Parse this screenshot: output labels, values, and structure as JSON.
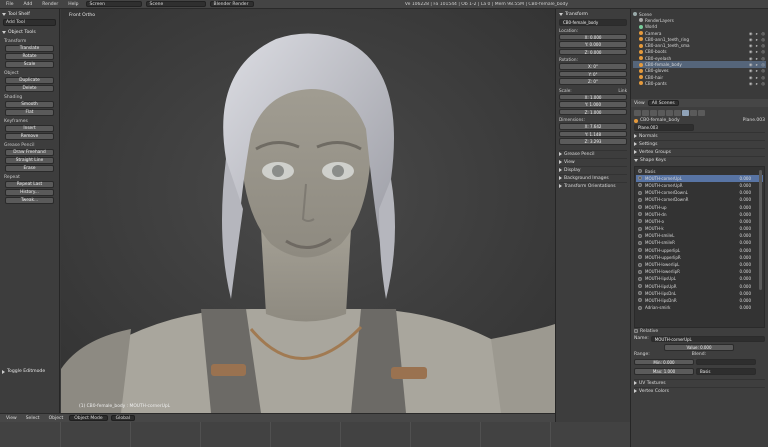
{
  "topbar": {
    "menus": [
      "File",
      "Add",
      "Render",
      "Help"
    ],
    "screen": "Screen",
    "scene": "Scene",
    "engine": "Blender Render",
    "stats": "Ve 106228 | Fa 101544 | Ob 1-2 | La 0 | Mem 98.55M | CB0-female_body"
  },
  "toolshelf": {
    "title": "Tool Shelf",
    "add_tool": "Add Tool",
    "object_tools": "Object Tools",
    "sections": [
      {
        "label": "Transform",
        "buttons": [
          "Translate",
          "Rotate",
          "Scale"
        ]
      },
      {
        "label": "Object",
        "buttons": [
          "Duplicate",
          "Delete"
        ]
      },
      {
        "label": "Shading",
        "buttons": [
          "Smooth",
          "Flat"
        ]
      },
      {
        "label": "Keyframes",
        "buttons": [
          "Insert",
          "Remove"
        ]
      },
      {
        "label": "Grease Pencil",
        "buttons": [
          "Draw Freehand",
          "Straight Line",
          "Erase"
        ]
      },
      {
        "label": "Repeat",
        "buttons": [
          "Repeat Last",
          "History...",
          "Tweak..."
        ]
      }
    ],
    "toggle_edit_mode": "Toggle Editmode"
  },
  "viewport": {
    "label": "Front Ortho",
    "object_label": "(1) CB0-female_body : MOUTH-cornerUpL"
  },
  "vp_header": {
    "items": [
      "View",
      "Select",
      "Object"
    ],
    "mode": "Object Mode",
    "pivot": "Global"
  },
  "nprops": {
    "transform_title": "Transform",
    "object_name": "CB0-female_body",
    "location_label": "Location:",
    "location": [
      "X: 0.000",
      "Y: 0.000",
      "Z: 0.000"
    ],
    "rotation_label": "Rotation:",
    "rotation": [
      "X: 0°",
      "Y: 0°",
      "Z: 0°"
    ],
    "scale_label": "Scale:",
    "scale_link": "Link",
    "scale": [
      "X: 1.000",
      "Y: 1.000",
      "Z: 1.000"
    ],
    "dimensions_label": "Dimensions:",
    "dimensions": [
      "X: 7.642",
      "Y: 1.148",
      "Z: 3.293"
    ],
    "collapsed": [
      "Grease Pencil",
      "View",
      "Display",
      "Background Images",
      "Transform Orientations"
    ]
  },
  "outliner": {
    "rows": [
      {
        "name": "Scene",
        "sel": false
      },
      {
        "name": "RenderLayers",
        "sel": false
      },
      {
        "name": "World",
        "sel": false
      },
      {
        "name": "Camera",
        "sel": false
      },
      {
        "name": "CB0-ann1_teeth_ring",
        "sel": false
      },
      {
        "name": "CB0-ann1_teeth_sma",
        "sel": false
      },
      {
        "name": "CB0-boots",
        "sel": false
      },
      {
        "name": "CB0-eyelash",
        "sel": false
      },
      {
        "name": "CB0-female_body",
        "sel": true
      },
      {
        "name": "CB0-gloves",
        "sel": false
      },
      {
        "name": "CB0-hair",
        "sel": false
      },
      {
        "name": "CB0-pants",
        "sel": false
      }
    ],
    "footer_view": "View",
    "footer_scope": "All Scenes"
  },
  "props": {
    "object_path": "CB0-female_body",
    "mesh_name": "Plane.003",
    "mesh_field": "Plane.003",
    "sections": [
      "Normals",
      "Settings",
      "Vertex Groups"
    ],
    "shape_keys_title": "Shape Keys",
    "shape_keys": [
      {
        "name": "Basis",
        "value": ""
      },
      {
        "name": "MOUTH-cornerUpL",
        "value": "0.000",
        "sel": true
      },
      {
        "name": "MOUTH-cornerUpR",
        "value": "0.000"
      },
      {
        "name": "MOUTH-cornerDownL",
        "value": "0.000"
      },
      {
        "name": "MOUTH-cornerDownR",
        "value": "0.000"
      },
      {
        "name": "MOUTH-up",
        "value": "0.000"
      },
      {
        "name": "MOUTH-dn",
        "value": "0.000"
      },
      {
        "name": "MOUTH-o",
        "value": "0.000"
      },
      {
        "name": "MOUTH-k",
        "value": "0.000"
      },
      {
        "name": "MOUTH-smileL",
        "value": "0.000"
      },
      {
        "name": "MOUTH-smileR",
        "value": "0.000"
      },
      {
        "name": "MOUTH-upperlipL",
        "value": "0.000"
      },
      {
        "name": "MOUTH-upperlipR",
        "value": "0.000"
      },
      {
        "name": "MOUTH-lowerlipL",
        "value": "0.000"
      },
      {
        "name": "MOUTH-lowerlipR",
        "value": "0.000"
      },
      {
        "name": "MOUTH-lipsUpL",
        "value": "0.000"
      },
      {
        "name": "MOUTH-lipsUpR",
        "value": "0.000"
      },
      {
        "name": "MOUTH-lipsDnL",
        "value": "0.000"
      },
      {
        "name": "MOUTH-lipsDnR",
        "value": "0.000"
      },
      {
        "name": "Adrian-smirk",
        "value": "0.000"
      }
    ],
    "relative": "Relative",
    "name_label": "Name:",
    "name_value": "MOUTH-cornerUpL",
    "value_field": "Value: 0.000",
    "range_label": "Range:",
    "blend_label": "Blend:",
    "range_min": "Min: 0.000",
    "range_max": "Max: 1.000",
    "blend_vg": "",
    "blend_basis": "Basis",
    "bottom_sections": [
      "UV Textures",
      "Vertex Colors"
    ]
  }
}
